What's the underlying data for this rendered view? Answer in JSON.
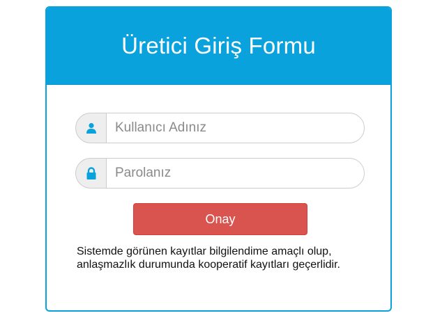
{
  "form": {
    "title": "Üretici Giriş Formu",
    "username": {
      "placeholder": "Kullanıcı Adınız",
      "value": "",
      "icon": "user-icon"
    },
    "password": {
      "placeholder": "Parolanız",
      "value": "",
      "icon": "lock-icon"
    },
    "submit_label": "Onay",
    "notice": "Sistemde görünen kayıtlar bilgilendime amaçlı olup, anlaşmazlık durumunda kooperatif kayıtları geçerlidir."
  },
  "colors": {
    "header": "#0aa2dc",
    "icon": "#0aa2dc",
    "button": "#d9534f"
  }
}
